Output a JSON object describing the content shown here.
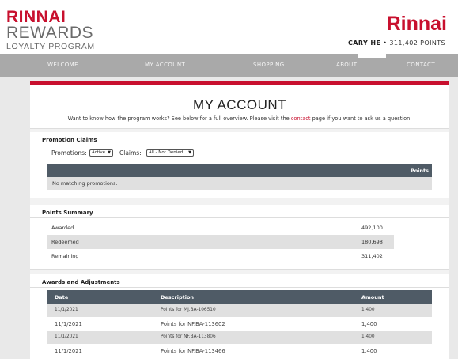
{
  "header": {
    "logo_line1": "RINNAI",
    "logo_line2": "REWARDS",
    "logo_line3": "LOYALTY PROGRAM",
    "brand": "Rinnai",
    "user_name": "CARY HE",
    "user_separator": "•",
    "user_points": "311,402 POINTS"
  },
  "nav": {
    "items": [
      {
        "label": "WELCOME"
      },
      {
        "label": "MY ACCOUNT"
      },
      {
        "label": "SHOPPING"
      },
      {
        "label": "ABOUT"
      },
      {
        "label": "CONTACT"
      }
    ]
  },
  "page": {
    "title": "MY ACCOUNT",
    "intro_before": "Want to know how the program works? See below for a full overview. Please visit the ",
    "intro_link": "contact",
    "intro_after": " page if you want to ask us a question."
  },
  "promotions": {
    "section_title": "Promotion Claims",
    "promotions_label": "Promotions:",
    "promotions_value": "Active",
    "claims_label": "Claims:",
    "claims_value": "All - Not Denied",
    "table_header": "Points",
    "empty_message": "No matching promotions."
  },
  "points_summary": {
    "section_title": "Points Summary",
    "rows": [
      {
        "label": "Awarded",
        "value": "492,100"
      },
      {
        "label": "Redeemed",
        "value": "180,698"
      },
      {
        "label": "Remaining",
        "value": "311,402"
      }
    ]
  },
  "awards": {
    "section_title": "Awards and Adjustments",
    "columns": [
      "Date",
      "Description",
      "Amount"
    ],
    "rows": [
      {
        "date": "11/1/2021",
        "description": "Points for MJ.BA-106510",
        "amount": "1,400"
      },
      {
        "date": "11/1/2021",
        "description": "Points for NF.BA-113602",
        "amount": "1,400"
      },
      {
        "date": "11/1/2021",
        "description": "Points for NF.BA-113806",
        "amount": "1,400"
      },
      {
        "date": "11/1/2021",
        "description": "Points for NF.BA-113466",
        "amount": "1,400"
      }
    ]
  },
  "colors": {
    "brand_red": "#c8102e",
    "nav_gray": "#a9a9a9",
    "table_header": "#4f5b66"
  }
}
